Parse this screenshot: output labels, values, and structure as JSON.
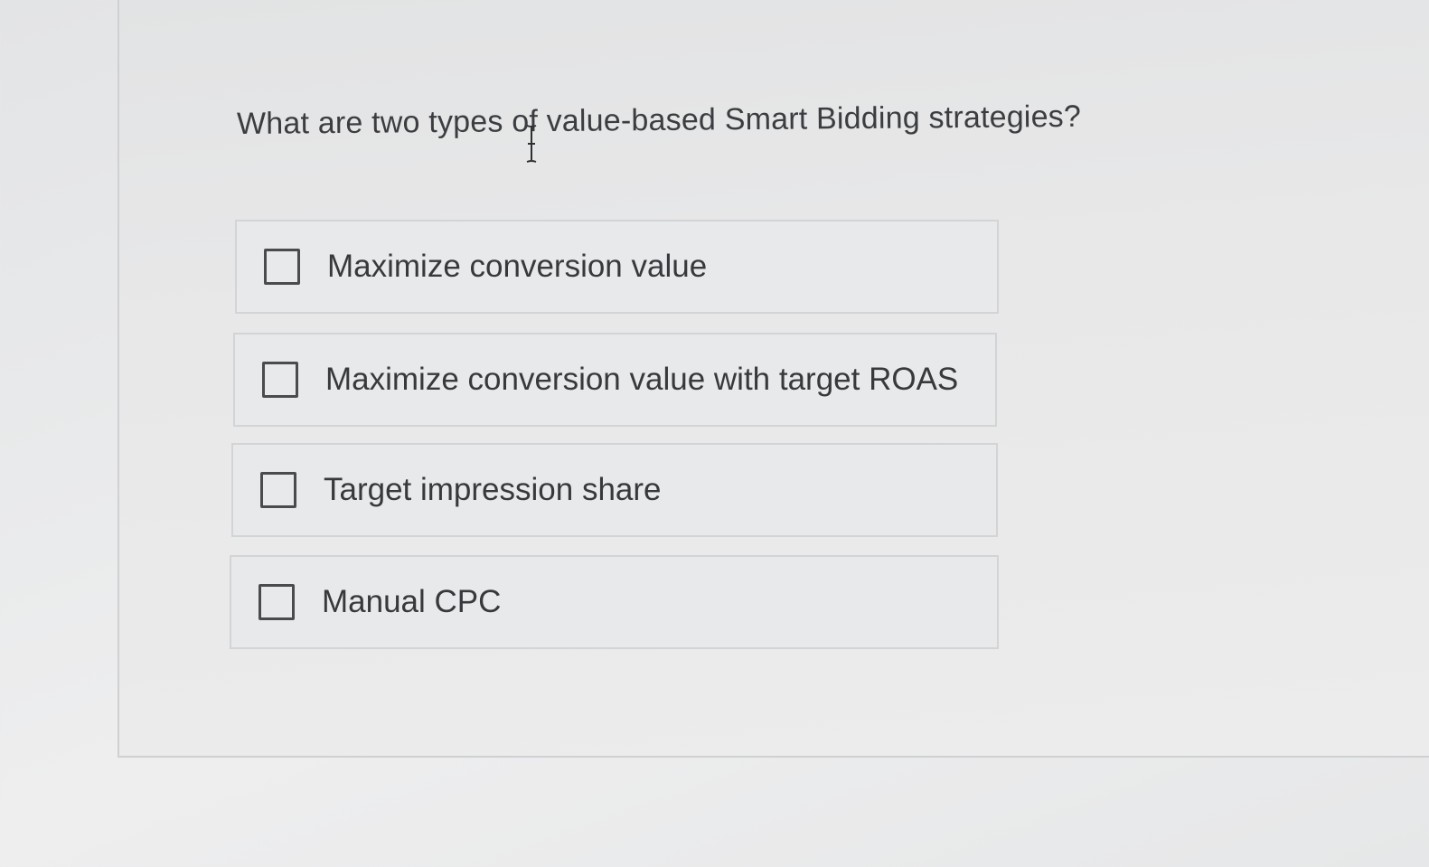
{
  "question": {
    "text": "What are two types of value-based Smart Bidding strategies?"
  },
  "options": [
    {
      "label": "Maximize conversion value",
      "checked": false
    },
    {
      "label": "Maximize conversion value with target ROAS",
      "checked": false
    },
    {
      "label": "Target impression share",
      "checked": false
    },
    {
      "label": "Manual CPC",
      "checked": false
    }
  ],
  "cursor": {
    "icon": "text-cursor-icon"
  }
}
